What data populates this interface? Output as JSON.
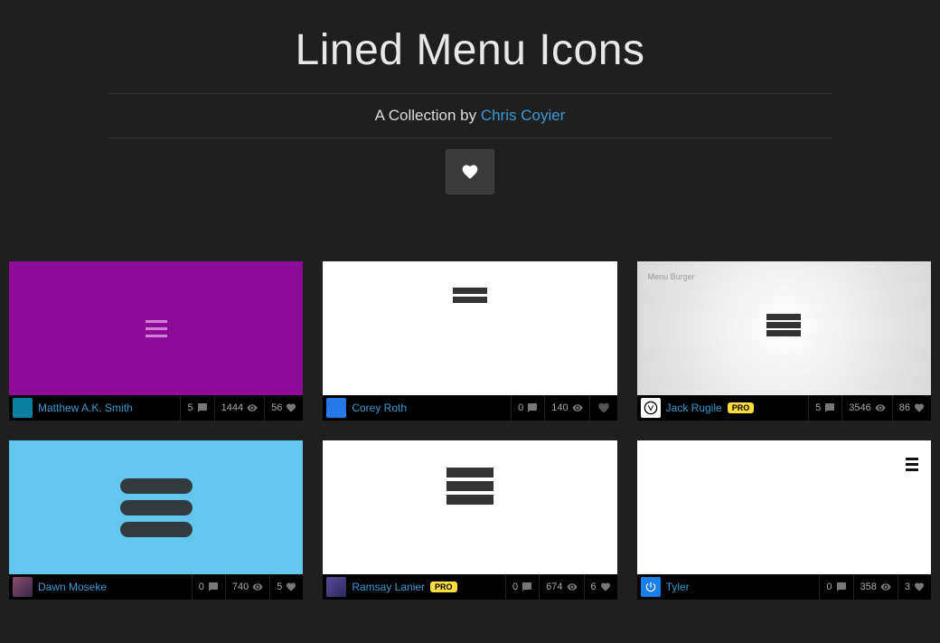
{
  "header": {
    "title": "Lined Menu Icons",
    "subtitle_prefix": "A Collection by ",
    "author": "Chris Coyier"
  },
  "preview_labels": {
    "menu_burger": "Menu Burger"
  },
  "pens": [
    {
      "author": "Matthew A.K. Smith",
      "pro": false,
      "comments": "5",
      "views": "1444",
      "loves": "56",
      "show_loves": true
    },
    {
      "author": "Corey Roth",
      "pro": false,
      "comments": "0",
      "views": "140",
      "loves": "",
      "show_loves": false
    },
    {
      "author": "Jack Rugile",
      "pro": true,
      "comments": "5",
      "views": "3546",
      "loves": "86",
      "show_loves": true
    },
    {
      "author": "Dawn Moseke",
      "pro": false,
      "comments": "0",
      "views": "740",
      "loves": "5",
      "show_loves": true
    },
    {
      "author": "Ramsay Lanier",
      "pro": true,
      "comments": "0",
      "views": "674",
      "loves": "6",
      "show_loves": true
    },
    {
      "author": "Tyler",
      "pro": false,
      "comments": "0",
      "views": "358",
      "loves": "3",
      "show_loves": true
    }
  ],
  "labels": {
    "pro": "PRO"
  }
}
